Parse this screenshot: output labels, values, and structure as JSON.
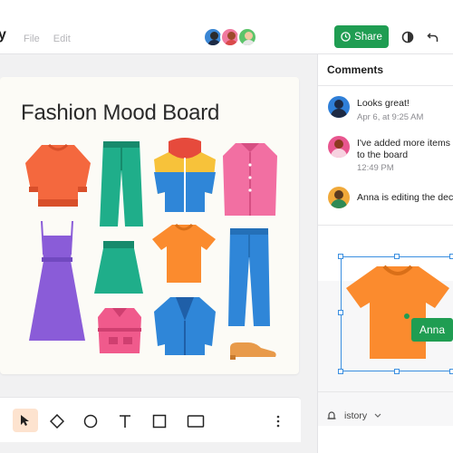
{
  "app": {
    "logo": "y",
    "menu": [
      "File",
      "Edit"
    ],
    "share_label": "Share"
  },
  "board": {
    "title": "Fashion Mood Board",
    "items": [
      "sweater",
      "pants",
      "jacket",
      "shirt",
      "dress",
      "skirt",
      "t-shirt",
      "jeans",
      "top",
      "cardigan",
      "shoes"
    ]
  },
  "toolbar": {
    "tools": [
      "select",
      "pen",
      "circle",
      "text",
      "square",
      "rectangle",
      "more"
    ]
  },
  "comments": {
    "title": "Comments",
    "items": [
      {
        "text": "Looks great!",
        "time": "Apr 6, at 9:25 AM",
        "avatar_color": "#2f7fd8"
      },
      {
        "text_lines": [
          "I've added more items",
          "to the board"
        ],
        "time": "12:49 PM",
        "avatar_color": "#e8568f"
      },
      {
        "text": "Anna is editing the dec",
        "avatar_color": "#f0a93a"
      }
    ]
  },
  "selection": {
    "label": "Anna"
  },
  "history_label": "istory",
  "colors": {
    "share_green": "#1f9d52",
    "selection_blue": "#3b8fe0",
    "tool_active": "#fde3cf"
  }
}
